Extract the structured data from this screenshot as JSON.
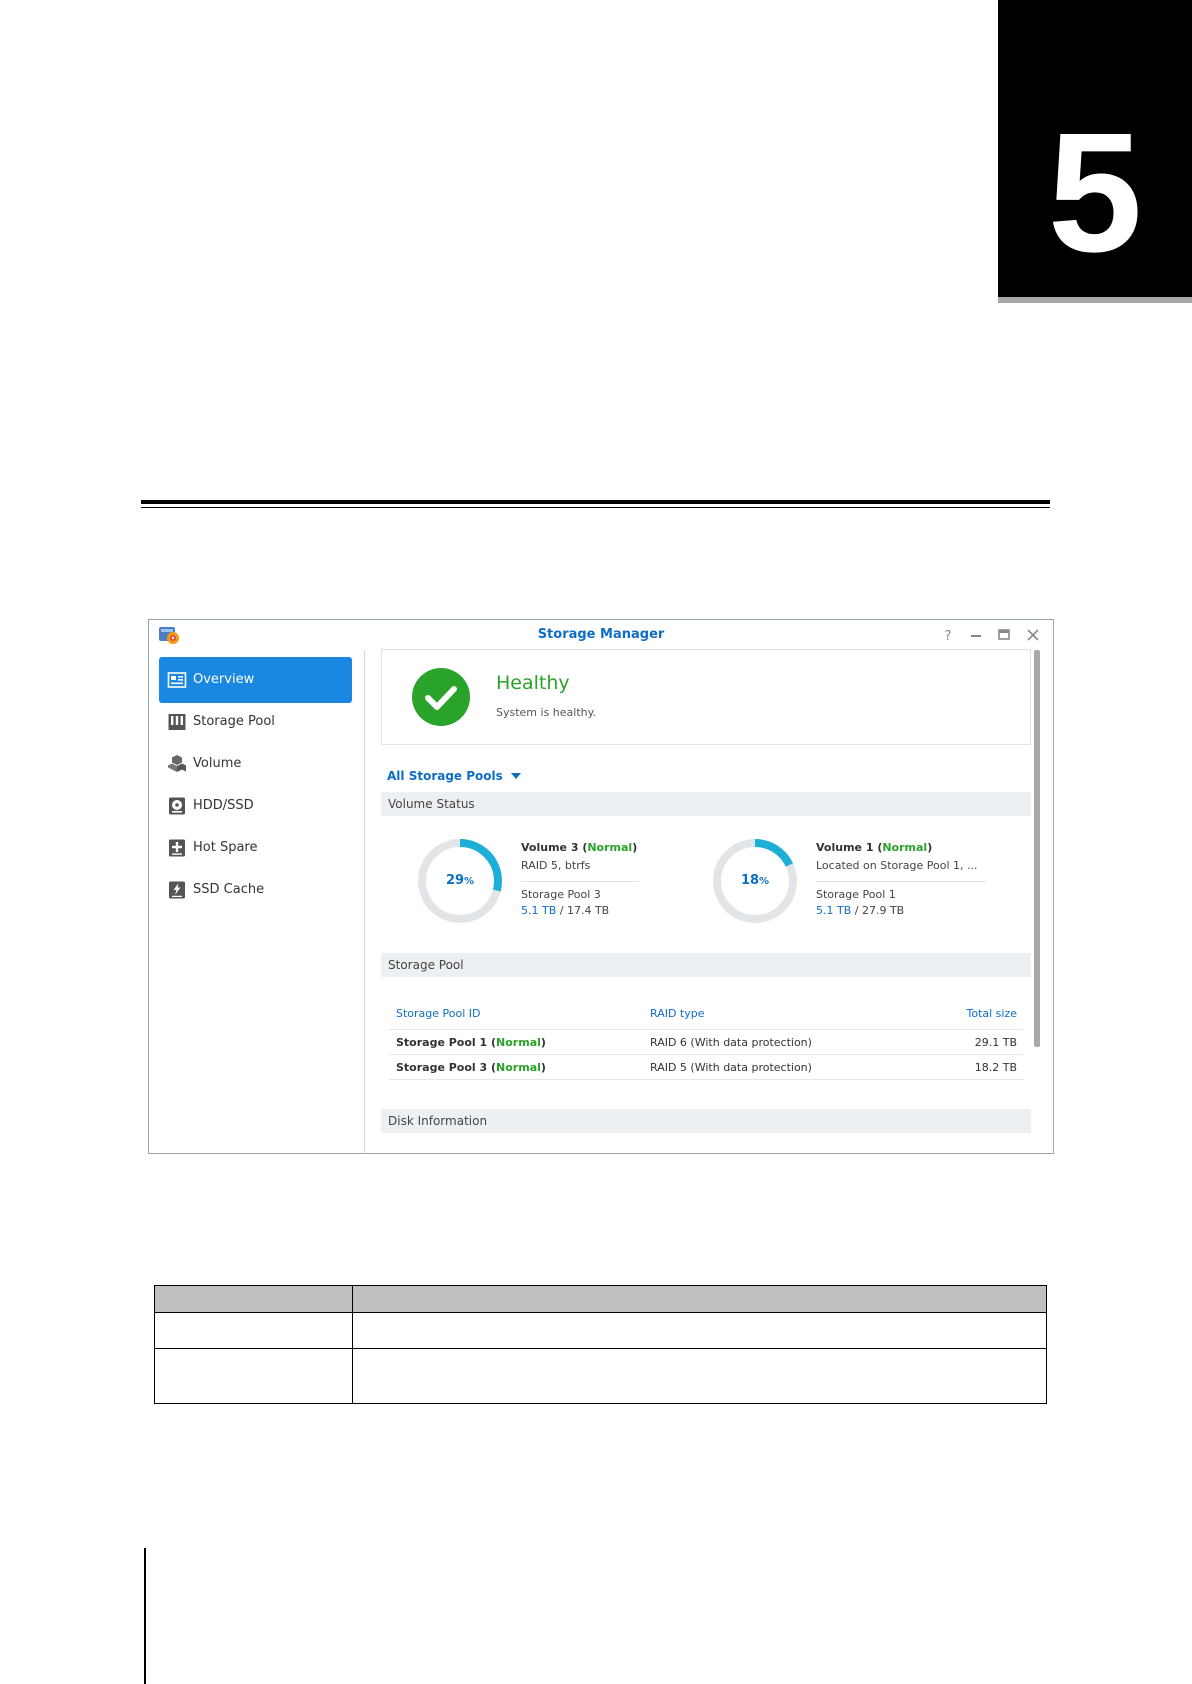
{
  "chapter": {
    "number": "5"
  },
  "window": {
    "title": "Storage Manager",
    "controls": {
      "help": "?",
      "minimize": "minimize",
      "maximize": "maximize",
      "close": "close"
    }
  },
  "sidebar": {
    "items": [
      {
        "label": "Overview",
        "icon": "overview-icon",
        "active": true
      },
      {
        "label": "Storage Pool",
        "icon": "storage-pool-icon",
        "active": false
      },
      {
        "label": "Volume",
        "icon": "volume-icon",
        "active": false
      },
      {
        "label": "HDD/SSD",
        "icon": "hdd-icon",
        "active": false
      },
      {
        "label": "Hot Spare",
        "icon": "hot-spare-icon",
        "active": false
      },
      {
        "label": "SSD Cache",
        "icon": "ssd-cache-icon",
        "active": false
      }
    ]
  },
  "health": {
    "title": "Healthy",
    "subtitle": "System is healthy."
  },
  "pools_filter": {
    "selected": "All Storage Pools"
  },
  "volume_status": {
    "section_label": "Volume Status",
    "volumes": [
      {
        "name": "Volume 3",
        "status": "Normal",
        "detail": "RAID 5, btrfs",
        "pool": "Storage Pool 3",
        "used": "5.1 TB",
        "total": "17.4 TB",
        "percent": 29,
        "percent_label": "29"
      },
      {
        "name": "Volume 1",
        "status": "Normal",
        "detail": "Located on Storage Pool 1, ...",
        "pool": "Storage Pool 1",
        "used": "5.1 TB",
        "total": "27.9 TB",
        "percent": 18,
        "percent_label": "18"
      }
    ]
  },
  "storage_pool": {
    "section_label": "Storage Pool",
    "columns": [
      "Storage Pool ID",
      "RAID type",
      "Total size"
    ],
    "rows": [
      {
        "id": "Storage Pool 1",
        "status": "Normal",
        "raid": "RAID 6 (With data protection)",
        "size": "29.1 TB"
      },
      {
        "id": "Storage Pool 3",
        "status": "Normal",
        "raid": "RAID 5 (With data protection)",
        "size": "18.2 TB"
      }
    ]
  },
  "disk_information": {
    "section_label": "Disk Information"
  },
  "colors": {
    "accent": "#1a88e0",
    "link": "#0e6ec6",
    "healthy": "#29a329",
    "donut_used": "#1cb0d8",
    "donut_track": "#e2e5e8"
  }
}
